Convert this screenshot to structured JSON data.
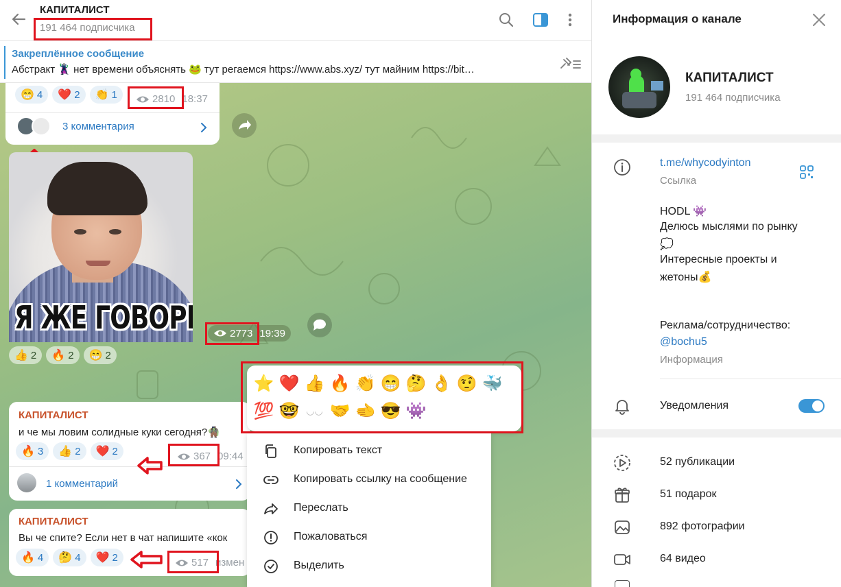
{
  "header": {
    "title": "КАПИТАЛИСТ",
    "subscribers": "191 464 подписчика"
  },
  "pinned": {
    "title": "Закреплённое сообщение",
    "text": "Абстракт 🦹 нет времени объяснять 🐸 тут регаемся https://www.abs.xyz/  тут майним https://bit…"
  },
  "messages": [
    {
      "reactions": [
        {
          "emoji": "😁",
          "count": "4"
        },
        {
          "emoji": "❤️",
          "count": "2"
        },
        {
          "emoji": "👏",
          "count": "1"
        }
      ],
      "views": "2810",
      "time": "18:37",
      "comments": "3 комментария"
    },
    {
      "sticker_caption": "Я ЖЕ ГОВОРИЛ",
      "views": "2773",
      "time": "19:39",
      "reactions": [
        {
          "emoji": "👍",
          "count": "2"
        },
        {
          "emoji": "🔥",
          "count": "2"
        },
        {
          "emoji": "😁",
          "count": "2"
        }
      ]
    },
    {
      "sender": "КАПИТАЛИСТ",
      "text": "и че мы ловим солидные куки сегодня?🧌",
      "reactions": [
        {
          "emoji": "🔥",
          "count": "3"
        },
        {
          "emoji": "👍",
          "count": "2"
        },
        {
          "emoji": "❤️",
          "count": "2"
        }
      ],
      "views": "367",
      "time": "09:44",
      "comments": "1 комментарий"
    },
    {
      "sender": "КАПИТАЛИСТ",
      "text": "Вы че спите? Если нет в чат напишите «кок",
      "reactions": [
        {
          "emoji": "🔥",
          "count": "4"
        },
        {
          "emoji": "🤔",
          "count": "4"
        },
        {
          "emoji": "❤️",
          "count": "2"
        }
      ],
      "views": "517",
      "time": "измен"
    }
  ],
  "emoji_picker": [
    "⭐",
    "❤️",
    "👍",
    "🔥",
    "👏",
    "😁",
    "🤔",
    "👌",
    "🤨",
    "🐳",
    "💯",
    "🤓",
    "◡◡",
    "🤝",
    "🫲",
    "😎",
    "👾"
  ],
  "context_menu": [
    {
      "icon": "copy-icon",
      "label": "Копировать текст"
    },
    {
      "icon": "link-icon",
      "label": "Копировать ссылку на сообщение"
    },
    {
      "icon": "forward-icon",
      "label": "Переслать"
    },
    {
      "icon": "report-icon",
      "label": "Пожаловаться"
    },
    {
      "icon": "select-icon",
      "label": "Выделить"
    }
  ],
  "info_panel": {
    "title": "Информация о канале",
    "channel_name": "КАПИТАЛИСТ",
    "subscribers": "191 464 подписчика",
    "link": "t.me/whycodyinton",
    "link_label": "Ссылка",
    "description": [
      "HODL 👾",
      "Делюсь мыслями по рынку",
      "💭",
      "Интересные проекты и",
      "жетоны💰",
      "Реклама/сотрудничество:"
    ],
    "description_link": "@bochu5",
    "description_label": "Информация",
    "notifications": "Уведомления",
    "notifications_on": true,
    "stats": [
      {
        "icon": "publications-icon",
        "label": "52 публикации"
      },
      {
        "icon": "gift-icon",
        "label": "51 подарок"
      },
      {
        "icon": "photo-icon",
        "label": "892 фотографии"
      },
      {
        "icon": "video-icon",
        "label": "64 видео"
      }
    ]
  },
  "colors": {
    "accent": "#3a96d6",
    "link": "#2b79c2",
    "sender": "#c8522b",
    "highlight": "#e0141e"
  }
}
